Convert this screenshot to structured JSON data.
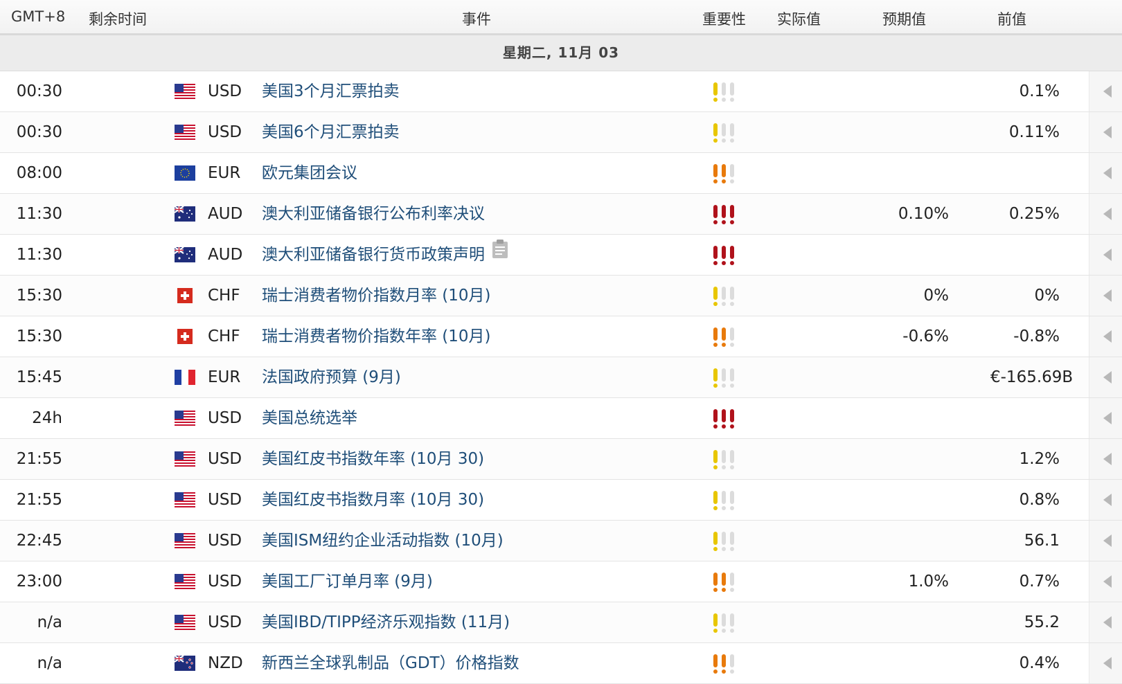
{
  "header": {
    "timezone": "GMT+8",
    "time_left": "剩余时间",
    "event": "事件",
    "importance": "重要性",
    "actual": "实际值",
    "forecast": "预期值",
    "previous": "前值"
  },
  "day": "星期二, 11月 03",
  "colors": {
    "low": "#e8c600",
    "medium": "#e87a0c",
    "high": "#b0121b",
    "inactive": "#dcdcdc",
    "event_link": "#1f4e79"
  },
  "rows": [
    {
      "time": "00:30",
      "flag": "us",
      "currency": "USD",
      "event": "美国3个月汇票拍卖",
      "importance": 1,
      "actual": "",
      "forecast": "",
      "previous": "0.1%"
    },
    {
      "time": "00:30",
      "flag": "us",
      "currency": "USD",
      "event": "美国6个月汇票拍卖",
      "importance": 1,
      "actual": "",
      "forecast": "",
      "previous": "0.11%"
    },
    {
      "time": "08:00",
      "flag": "eu",
      "currency": "EUR",
      "event": "欧元集团会议",
      "importance": 2,
      "actual": "",
      "forecast": "",
      "previous": ""
    },
    {
      "time": "11:30",
      "flag": "au",
      "currency": "AUD",
      "event": "澳大利亚储备银行公布利率决议",
      "importance": 3,
      "actual": "",
      "forecast": "0.10%",
      "previous": "0.25%"
    },
    {
      "time": "11:30",
      "flag": "au",
      "currency": "AUD",
      "event": "澳大利亚储备银行货币政策声明",
      "importance": 3,
      "actual": "",
      "forecast": "",
      "previous": "",
      "memo": true
    },
    {
      "time": "15:30",
      "flag": "ch",
      "currency": "CHF",
      "event": "瑞士消费者物价指数月率 (10月)",
      "importance": 1,
      "actual": "",
      "forecast": "0%",
      "previous": "0%"
    },
    {
      "time": "15:30",
      "flag": "ch",
      "currency": "CHF",
      "event": "瑞士消费者物价指数年率 (10月)",
      "importance": 2,
      "actual": "",
      "forecast": "-0.6%",
      "previous": "-0.8%"
    },
    {
      "time": "15:45",
      "flag": "fr",
      "currency": "EUR",
      "event": "法国政府预算 (9月)",
      "importance": 1,
      "actual": "",
      "forecast": "",
      "previous": "€-165.69B"
    },
    {
      "time": "24h",
      "flag": "us",
      "currency": "USD",
      "event": "美国总统选举",
      "importance": 3,
      "actual": "",
      "forecast": "",
      "previous": ""
    },
    {
      "time": "21:55",
      "flag": "us",
      "currency": "USD",
      "event": "美国红皮书指数年率 (10月 30)",
      "importance": 1,
      "actual": "",
      "forecast": "",
      "previous": "1.2%"
    },
    {
      "time": "21:55",
      "flag": "us",
      "currency": "USD",
      "event": "美国红皮书指数月率 (10月 30)",
      "importance": 1,
      "actual": "",
      "forecast": "",
      "previous": "0.8%"
    },
    {
      "time": "22:45",
      "flag": "us",
      "currency": "USD",
      "event": "美国ISM纽约企业活动指数 (10月)",
      "importance": 1,
      "actual": "",
      "forecast": "",
      "previous": "56.1"
    },
    {
      "time": "23:00",
      "flag": "us",
      "currency": "USD",
      "event": "美国工厂订单月率 (9月)",
      "importance": 2,
      "actual": "",
      "forecast": "1.0%",
      "previous": "0.7%"
    },
    {
      "time": "n/a",
      "flag": "us",
      "currency": "USD",
      "event": "美国IBD/TIPP经济乐观指数 (11月)",
      "importance": 1,
      "actual": "",
      "forecast": "",
      "previous": "55.2"
    },
    {
      "time": "n/a",
      "flag": "nz",
      "currency": "NZD",
      "event": "新西兰全球乳制品（GDT）价格指数",
      "importance": 2,
      "actual": "",
      "forecast": "",
      "previous": "0.4%"
    }
  ]
}
